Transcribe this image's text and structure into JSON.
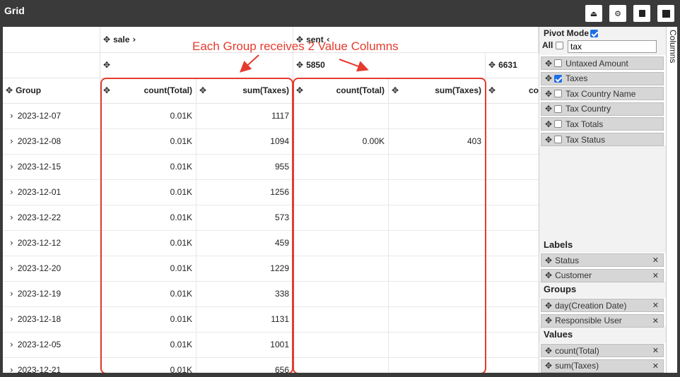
{
  "window": {
    "title": "Grid"
  },
  "toolbar": {
    "icons": [
      "export-icon",
      "settings-icon",
      "copy-icon",
      "archive-icon"
    ]
  },
  "annotation": {
    "text": "Each Group receives 2 Value Columns",
    "color": "#e53b2e"
  },
  "grid": {
    "header_row1": {
      "sale": "sale",
      "sale_chevron": "›",
      "sent": "sent",
      "sent_chevron": "‹"
    },
    "header_row2": {
      "sub1": "5850",
      "sub2": "6631"
    },
    "header_row3": {
      "group": "Group",
      "c1": "count(Total)",
      "c2": "sum(Taxes)",
      "c3": "count(Total)",
      "c4": "sum(Taxes)",
      "c5": "co"
    },
    "rows": [
      {
        "date": "2023-12-07",
        "c1": "0.01K",
        "c2": "1117",
        "c3": "",
        "c4": ""
      },
      {
        "date": "2023-12-08",
        "c1": "0.01K",
        "c2": "1094",
        "c3": "0.00K",
        "c4": "403"
      },
      {
        "date": "2023-12-15",
        "c1": "0.01K",
        "c2": "955",
        "c3": "",
        "c4": ""
      },
      {
        "date": "2023-12-01",
        "c1": "0.01K",
        "c2": "1256",
        "c3": "",
        "c4": ""
      },
      {
        "date": "2023-12-22",
        "c1": "0.01K",
        "c2": "573",
        "c3": "",
        "c4": ""
      },
      {
        "date": "2023-12-12",
        "c1": "0.01K",
        "c2": "459",
        "c3": "",
        "c4": ""
      },
      {
        "date": "2023-12-20",
        "c1": "0.01K",
        "c2": "1229",
        "c3": "",
        "c4": ""
      },
      {
        "date": "2023-12-19",
        "c1": "0.01K",
        "c2": "338",
        "c3": "",
        "c4": ""
      },
      {
        "date": "2023-12-18",
        "c1": "0.01K",
        "c2": "1131",
        "c3": "",
        "c4": ""
      },
      {
        "date": "2023-12-05",
        "c1": "0.01K",
        "c2": "1001",
        "c3": "",
        "c4": ""
      },
      {
        "date": "2023-12-21",
        "c1": "0.01K",
        "c2": "656",
        "c3": "",
        "c4": ""
      }
    ]
  },
  "sidebar": {
    "pivot_mode_label": "Pivot Mode",
    "pivot_mode_on": true,
    "all_label": "All",
    "search_value": "tax",
    "columns_tab_label": "Columns",
    "columns": [
      {
        "label": "Untaxed Amount",
        "checked": false
      },
      {
        "label": "Taxes",
        "checked": true
      },
      {
        "label": "Tax Country Name",
        "checked": false
      },
      {
        "label": "Tax Country",
        "checked": false
      },
      {
        "label": "Tax Totals",
        "checked": false
      },
      {
        "label": "Tax Status",
        "checked": false
      }
    ],
    "labels_title": "Labels",
    "labels": [
      "Status",
      "Customer"
    ],
    "groups_title": "Groups",
    "groups": [
      "day(Creation Date)",
      "Responsible User"
    ],
    "values_title": "Values",
    "values": [
      "count(Total)",
      "sum(Taxes)"
    ]
  }
}
